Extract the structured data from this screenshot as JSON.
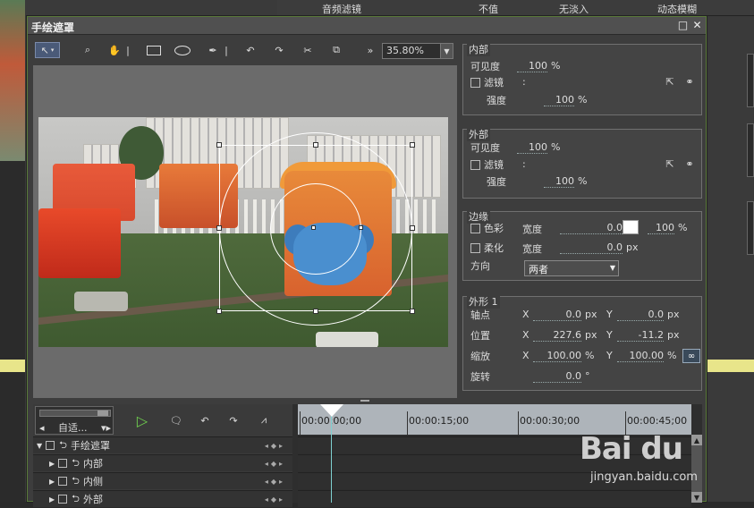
{
  "background": {
    "top_label": "音频滤镜",
    "top_right_labels": [
      "不值",
      "无淡入",
      "动态模糊"
    ]
  },
  "dialog": {
    "title": "手绘遮罩",
    "zoom": "35.80%"
  },
  "inner": {
    "legend": "内部",
    "visibility_label": "可见度",
    "visibility_value": "100",
    "visibility_unit": "%",
    "filter_label": "滤镜",
    "filter_colon": ":",
    "strength_label": "强度",
    "strength_value": "100",
    "strength_unit": "%"
  },
  "outer": {
    "legend": "外部",
    "visibility_label": "可见度",
    "visibility_value": "100",
    "visibility_unit": "%",
    "filter_label": "滤镜",
    "filter_colon": ":",
    "strength_label": "强度",
    "strength_value": "100",
    "strength_unit": "%"
  },
  "edge": {
    "legend": "边缘",
    "color_label": "色彩",
    "width_label": "宽度",
    "color_width_value": "0.0",
    "color_width_unit": "px",
    "color_percent_value": "100",
    "color_percent_unit": "%",
    "soften_label": "柔化",
    "soften_width_value": "0.0",
    "soften_width_unit": "px",
    "direction_label": "方向",
    "direction_value": "两者"
  },
  "shape": {
    "legend": "外形 1",
    "anchor_label": "轴点",
    "position_label": "位置",
    "scale_label": "缩放",
    "rotation_label": "旋转",
    "x_label": "X",
    "y_label": "Y",
    "anchor_x": "0.0",
    "anchor_y": "0.0",
    "position_x": "227.6",
    "position_y": "-11.2",
    "scale_x": "100.00",
    "scale_y": "100.00",
    "rotation": "0.0",
    "px_unit": "px",
    "pct_unit": "%",
    "deg_unit": "°"
  },
  "timeline": {
    "auto_label": "自适...",
    "ruler": [
      "00:00:00;00",
      "00:00:15;00",
      "00:00:30;00",
      "00:00:45;00"
    ],
    "tracks": [
      {
        "name": "手绘遮罩"
      },
      {
        "name": "内部"
      },
      {
        "name": "内侧"
      },
      {
        "name": "外部"
      }
    ]
  },
  "watermark": {
    "logo": "Bai du",
    "url": "jingyan.baidu.com"
  }
}
